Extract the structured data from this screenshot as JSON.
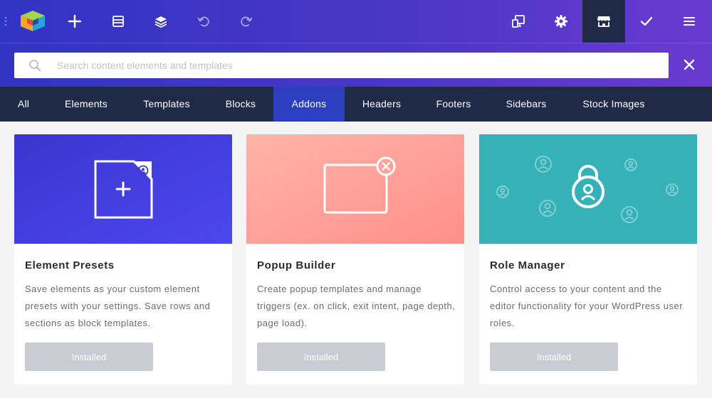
{
  "search": {
    "placeholder": "Search content elements and templates"
  },
  "toolbar": {
    "icons": [
      "drag-handle-icon",
      "logo-icon",
      "plus-icon",
      "layout-icon",
      "layers-icon",
      "undo-icon",
      "redo-icon",
      "responsive-icon",
      "gear-icon",
      "hub-store-icon",
      "check-icon",
      "menu-icon"
    ]
  },
  "tabs": {
    "items": [
      {
        "label": "All"
      },
      {
        "label": "Elements"
      },
      {
        "label": "Templates"
      },
      {
        "label": "Blocks"
      },
      {
        "label": "Addons"
      },
      {
        "label": "Headers"
      },
      {
        "label": "Footers"
      },
      {
        "label": "Sidebars"
      },
      {
        "label": "Stock Images"
      }
    ],
    "active": "Addons"
  },
  "cards": [
    {
      "title": "Element Presets",
      "description": "Save elements as your custom element presets with your settings. Save rows and sections as block templates.",
      "button_label": "Installed",
      "icon": "element-preset-icon"
    },
    {
      "title": "Popup Builder",
      "description": "Create popup templates and manage triggers (ex. on click, exit intent, page depth, page load).",
      "button_label": "Installed",
      "icon": "popup-window-icon"
    },
    {
      "title": "Role Manager",
      "description": "Control access to your content and the editor functionality for your WordPress user roles.",
      "button_label": "Installed",
      "icon": "role-lock-icon"
    }
  ],
  "colors": {
    "header_start": "#3134c3",
    "header_end": "#6a3ad0",
    "tabs_bg": "#1e2a47",
    "tab_active": "#2c3fc1",
    "card1_start": "#3f38d8",
    "card2_start": "#ffb2a6",
    "card3_bg": "#35b1b7",
    "installed_button": "#c9ccd3"
  }
}
